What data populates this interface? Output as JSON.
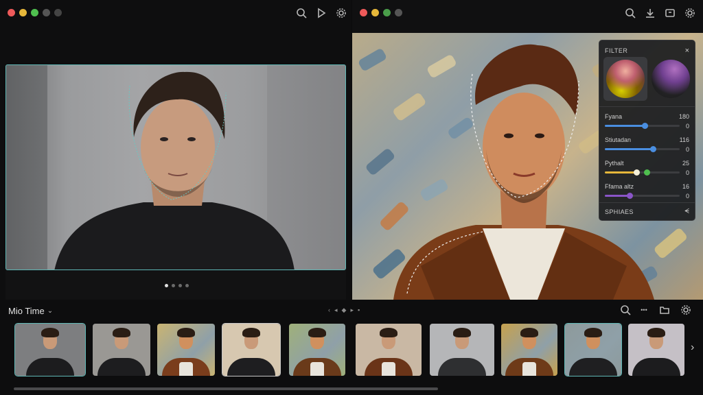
{
  "left_window": {
    "traffic_lights": [
      "#ee5a5a",
      "#e6b73a",
      "#4fbf4f",
      "#555555",
      "#444444"
    ],
    "toolbar_icons": [
      "search-icon",
      "play-icon",
      "gear-icon"
    ]
  },
  "right_window": {
    "traffic_lights": [
      "#ee5a5a",
      "#e6b73a",
      "#4a9d4a",
      "#555555"
    ],
    "toolbar_icons": [
      "search-icon",
      "download-icon",
      "frame-icon",
      "gear-icon"
    ]
  },
  "carousel": {
    "count": 4,
    "active_index": 0
  },
  "filter_panel": {
    "title": "FILTER",
    "close_icon": "×",
    "wheels": [
      "warm-color-wheel",
      "cool-color-wheel"
    ],
    "selected_wheel": 0,
    "sliders": [
      {
        "label": "Fyana",
        "value": "180",
        "value2": "0",
        "level": 0.53,
        "color": "#4a8ee0"
      },
      {
        "label": "Stiutadan",
        "value": "116",
        "value2": "0",
        "level": 0.64,
        "color": "#4a8ee0"
      },
      {
        "label": "Pythalt",
        "value": "25",
        "value2": "0",
        "level": 0.42,
        "color": "#e6b73a",
        "second_knob": "#4fbf4f",
        "second_level": 0.56
      },
      {
        "label": "Ffama altz",
        "value": "16",
        "value2": "0",
        "level": 0.33,
        "color": "#8a55c8"
      }
    ],
    "footer_label": "SPHIAES",
    "footer_icon": "ᗕ"
  },
  "filmstrip": {
    "title": "Mio Time",
    "title_chevron": "⌄",
    "mid_controls": [
      "‹",
      "◂",
      "◆",
      "▸",
      "▪"
    ],
    "icons": [
      "search-icon",
      "more-icon",
      "folder-icon",
      "gear-icon"
    ],
    "more_label": "•••",
    "next_arrow": "›",
    "thumbnails": [
      {
        "style": "photo",
        "bg": "#7d7e80",
        "body": "#1c1c1e",
        "selected": "teal"
      },
      {
        "style": "photo",
        "bg": "#9a9894",
        "body": "#1d1d1f",
        "selected": ""
      },
      {
        "style": "paint",
        "bg": "#c9b472",
        "body": "#7a3d1c",
        "selected": ""
      },
      {
        "style": "photo",
        "bg": "#d7c8b0",
        "body": "#1e1e20",
        "selected": "gray"
      },
      {
        "style": "paint",
        "bg": "#9fb07a",
        "body": "#6a3a1a",
        "selected": ""
      },
      {
        "style": "photo",
        "bg": "#c9b8a4",
        "body": "#6a3418",
        "selected": ""
      },
      {
        "style": "photo",
        "bg": "#b5b6b8",
        "body": "#2e2f31",
        "selected": ""
      },
      {
        "style": "paint",
        "bg": "#c6a14e",
        "body": "#6e3a18",
        "selected": ""
      },
      {
        "style": "paint",
        "bg": "#8d9a9c",
        "body": "#1f1f21",
        "selected": "teal"
      },
      {
        "style": "photo",
        "bg": "#c5c0c6",
        "body": "#1c1c1e",
        "selected": ""
      }
    ]
  }
}
